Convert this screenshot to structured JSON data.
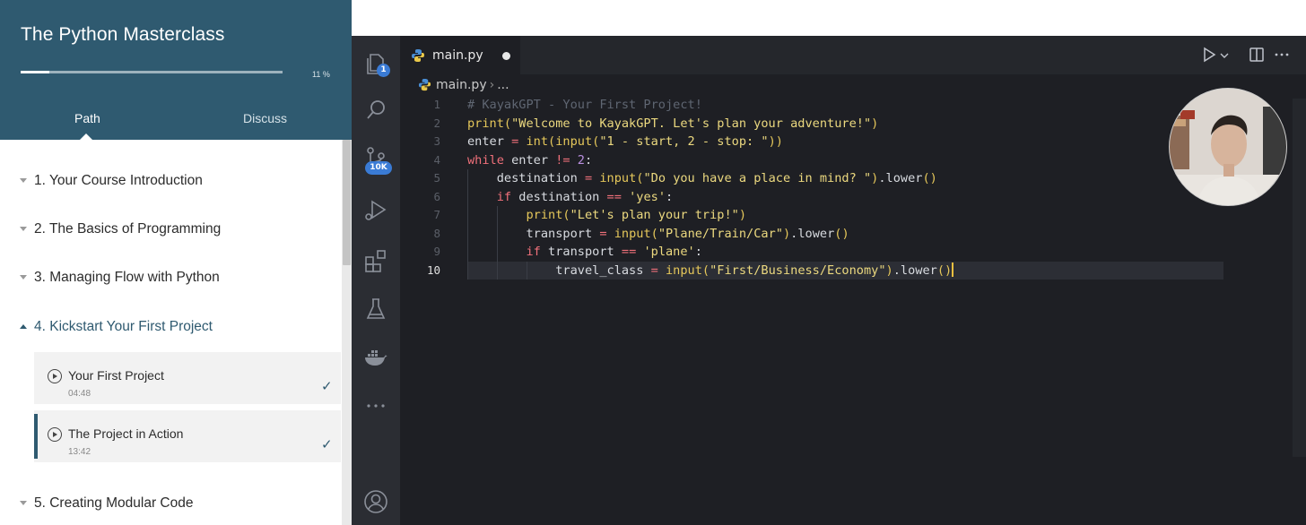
{
  "course": {
    "title": "The Python Masterclass",
    "progress_percent": 11,
    "progress_label": "11 %",
    "tabs": [
      {
        "label": "Path",
        "active": true
      },
      {
        "label": "Discuss",
        "active": false
      }
    ],
    "sections": [
      {
        "label": "1. Your Course Introduction",
        "expanded": false
      },
      {
        "label": "2. The Basics of Programming",
        "expanded": false
      },
      {
        "label": "3. Managing Flow with Python",
        "expanded": false
      },
      {
        "label": "4. Kickstart Your First Project",
        "expanded": true
      },
      {
        "label": "5. Creating Modular Code",
        "expanded": false
      }
    ],
    "lessons": [
      {
        "title": "Your First Project",
        "duration": "04:48",
        "completed": true,
        "current": false
      },
      {
        "title": "The Project in Action",
        "duration": "13:42",
        "completed": true,
        "current": true
      }
    ],
    "colors": {
      "header": "#2f5a70",
      "accent": "#2f5a70"
    }
  },
  "editor": {
    "activity_bar": [
      {
        "icon": "explorer-icon",
        "badge": "1"
      },
      {
        "icon": "search-icon",
        "badge": ""
      },
      {
        "icon": "source-control-icon",
        "badge": "10K"
      },
      {
        "icon": "run-debug-icon",
        "badge": ""
      },
      {
        "icon": "extensions-icon",
        "badge": ""
      },
      {
        "icon": "testing-icon",
        "badge": ""
      },
      {
        "icon": "docker-icon",
        "badge": ""
      },
      {
        "icon": "more-icon",
        "badge": ""
      },
      {
        "icon": "accounts-icon",
        "badge": ""
      }
    ],
    "tab": {
      "label": "main.py",
      "dirty": true
    },
    "breadcrumb": {
      "file": "main.py",
      "more": "..."
    },
    "line_numbers": [
      "1",
      "2",
      "3",
      "4",
      "5",
      "6",
      "7",
      "8",
      "9",
      "10"
    ],
    "current_line": "10",
    "code": [
      "# KayakGPT - Your First Project!",
      "print(\"Welcome to KayakGPT. Let's plan your adventure!\")",
      "enter = int(input(\"1 - start, 2 - stop: \"))",
      "while enter != 2:",
      "    destination = input(\"Do you have a place in mind? \").lower()",
      "    if destination == 'yes':",
      "        print(\"Let's plan your trip!\")",
      "        transport = input(\"Plane/Train/Car\").lower()",
      "        if transport == 'plane':",
      "            travel_class = input(\"First/Business/Economy\").lower()"
    ],
    "tokens": {
      "l1": {
        "comment": "# KayakGPT - Your First Project!"
      },
      "l2": {
        "fn": "print",
        "open": "(",
        "str": "\"Welcome to KayakGPT. Let's plan your adventure!\"",
        "close": ")"
      },
      "l3": {
        "var": "enter",
        "op": " = ",
        "fn1": "int",
        "p1": "(",
        "fn2": "input",
        "p2": "(",
        "str": "\"1 - start, 2 - stop: \"",
        "close": "))"
      },
      "l4": {
        "kw": "while",
        "var": " enter ",
        "op": "!=",
        "num": " 2",
        "colon": ":"
      },
      "l5": {
        "indent": "    ",
        "var": "destination",
        "op": " = ",
        "fn": "input",
        "open": "(",
        "str": "\"Do you have a place in mind? \"",
        "close": ")",
        "meth": ".lower",
        "call": "()"
      },
      "l6": {
        "indent": "    ",
        "kw": "if",
        "var": " destination ",
        "op": "==",
        "str": " 'yes'",
        "colon": ":"
      },
      "l7": {
        "indent": "        ",
        "fn": "print",
        "open": "(",
        "str": "\"Let's plan your trip!\"",
        "close": ")"
      },
      "l8": {
        "indent": "        ",
        "var": "transport",
        "op": " = ",
        "fn": "input",
        "open": "(",
        "str": "\"Plane/Train/Car\"",
        "close": ")",
        "meth": ".lower",
        "call": "()"
      },
      "l9": {
        "indent": "        ",
        "kw": "if",
        "var": " transport ",
        "op": "==",
        "str": " 'plane'",
        "colon": ":"
      },
      "l10": {
        "indent": "            ",
        "var": "travel_class",
        "op": " = ",
        "fn": "input",
        "open": "(",
        "str": "\"First/Business/Economy\"",
        "close": ")",
        "meth": ".lower",
        "call": "()"
      }
    },
    "toolbar": [
      {
        "icon": "run-icon"
      },
      {
        "icon": "chevron-down-icon"
      },
      {
        "icon": "split-editor-icon"
      },
      {
        "icon": "more-actions-icon"
      }
    ],
    "colors": {
      "background": "#1e1f24",
      "activity_bar": "#2b2d33",
      "badge": "#3a7bd5",
      "keyword": "#f0707a",
      "function": "#e5c75a",
      "string": "#ecd97f",
      "comment": "#5f6672"
    }
  }
}
